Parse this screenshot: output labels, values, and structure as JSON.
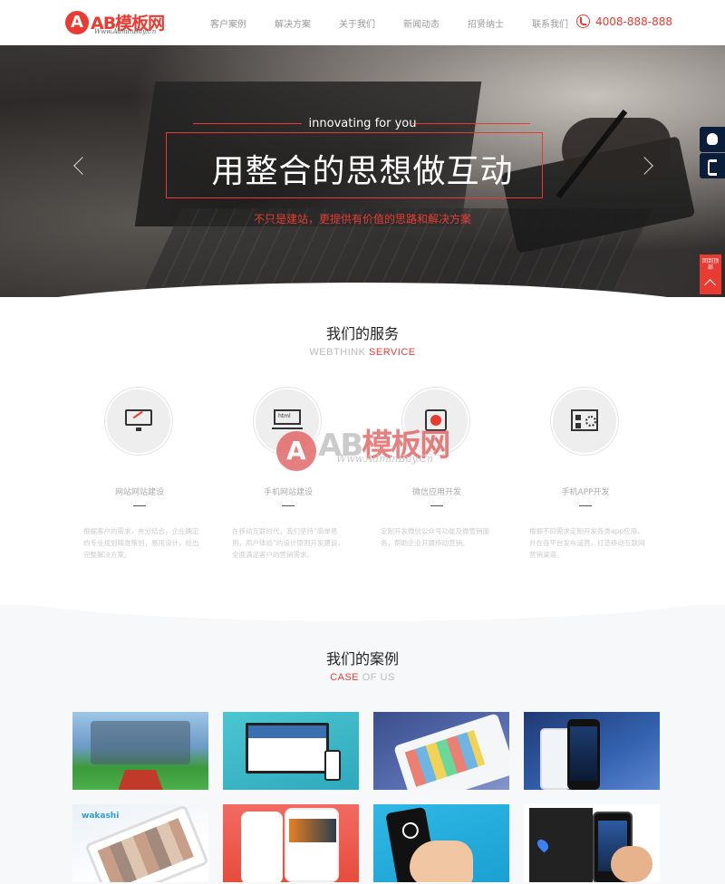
{
  "header": {
    "logo_text": "AB模板网",
    "logo_sub": "Www.AdminBuy.Cn",
    "nav": [
      "客户案例",
      "解决方案",
      "关于我们",
      "新闻动态",
      "招贤纳士",
      "联系我们"
    ],
    "phone": "4008-888-888",
    "accent_color": "#e83b32"
  },
  "banner": {
    "tagline": "innovating for you",
    "headline": "用整合的思想做互动",
    "slogan": "不只是建站，更提供有价值的思路和解决方案"
  },
  "side_float": {
    "top_label": "回到顶部"
  },
  "services": {
    "title": "我们的服务",
    "sub_prefix": "WEBTHINK",
    "sub_highlight": "SERVICE",
    "items": [
      {
        "icon": "monitor-icon",
        "name": "网站网站建设",
        "desc": "根据客户的需求，充分结合，企业确定的专业规划精准策划，易用设计，给出完整解决方案。"
      },
      {
        "icon": "pc-icon",
        "name": "手机网站建设",
        "desc": "在移动互联时代，我们坚持“简单易用，用户体验”的设计原则开发建设，全面满足客户的营销需求。"
      },
      {
        "icon": "cards-icon",
        "name": "微信应用开发",
        "desc": "定制开发微信公众号功能及微营销服务，帮助企业开展移动营销。"
      },
      {
        "icon": "app-icon",
        "name": "手机APP开发",
        "desc": "根据不同需求定制开发各类app应用，并在各平台发布运营，打造移动互联网营销渠道。"
      }
    ]
  },
  "watermark": {
    "text_gray": "AB",
    "text_red": "模板网",
    "url": "Www.AdminBuy.Cn"
  },
  "cases": {
    "title": "我们的案例",
    "sub_highlight": "CASE",
    "sub_rest": "OF US",
    "thumb5_logo": "wakashi",
    "items": [
      "case-1",
      "case-2",
      "case-3",
      "case-4",
      "case-5",
      "case-6",
      "case-7",
      "case-8"
    ]
  }
}
